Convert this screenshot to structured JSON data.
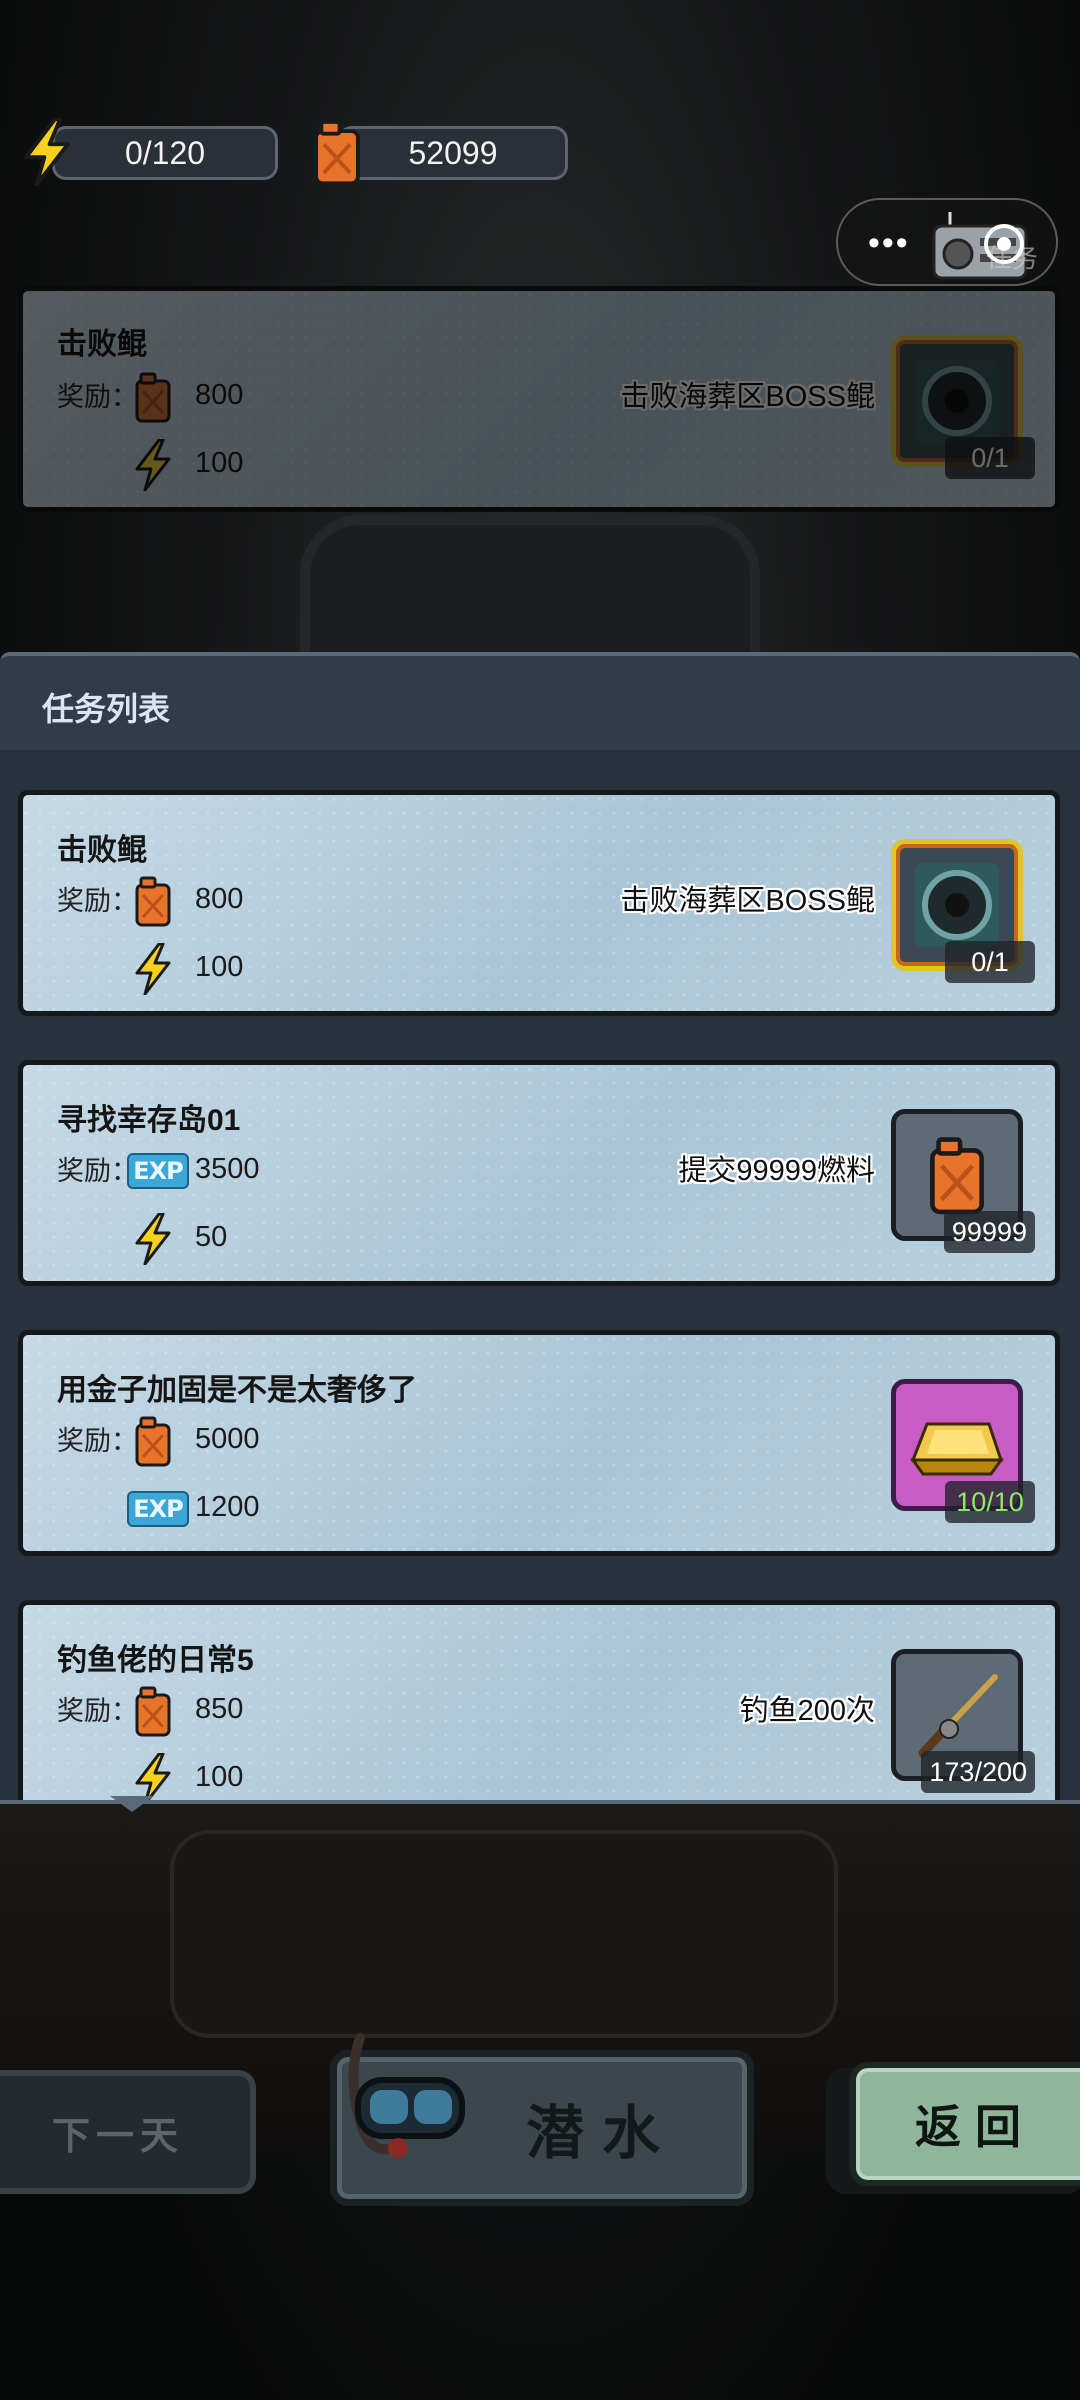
{
  "resources": {
    "energy": "0/120",
    "fuel": "52099"
  },
  "capsule": {
    "dots": "•••",
    "label": "任务"
  },
  "featured_quest": {
    "title": "击败鲲",
    "reward_label": "奖励：",
    "rewards": [
      {
        "icon": "fuel-can-icon",
        "value": "800"
      },
      {
        "icon": "lightning-icon",
        "value": "100"
      }
    ],
    "description": "击败海葬区BOSS鲲",
    "item_icon": "vault-icon",
    "progress": "0/1"
  },
  "panel": {
    "title": "任务列表"
  },
  "quests": [
    {
      "title": "击败鲲",
      "reward_label": "奖励：",
      "rewards": [
        {
          "icon": "fuel-can-icon",
          "value": "800"
        },
        {
          "icon": "lightning-icon",
          "value": "100"
        }
      ],
      "description": "击败海葬区BOSS鲲",
      "item_icon": "vault-icon",
      "progress": "0/1"
    },
    {
      "title": "寻找幸存岛01",
      "reward_label": "奖励：",
      "rewards": [
        {
          "icon": "exp-icon",
          "value": "3500"
        },
        {
          "icon": "lightning-icon",
          "value": "50"
        }
      ],
      "description": "提交99999燃料",
      "item_icon": "fuel-can-icon",
      "progress": "99999"
    },
    {
      "title": "用金子加固是不是太奢侈了",
      "reward_label": "奖励：",
      "rewards": [
        {
          "icon": "fuel-can-icon",
          "value": "5000"
        },
        {
          "icon": "exp-icon",
          "value": "1200"
        }
      ],
      "description": "",
      "item_icon": "gold-bar-icon",
      "progress": "10/10"
    },
    {
      "title": "钓鱼佬的日常5",
      "reward_label": "奖励：",
      "rewards": [
        {
          "icon": "fuel-can-icon",
          "value": "850"
        },
        {
          "icon": "lightning-icon",
          "value": "100"
        }
      ],
      "description": "钓鱼200次",
      "item_icon": "fishing-rod-icon",
      "progress": "173/200"
    }
  ],
  "exp_text": "EXP",
  "buttons": {
    "next_day": "下一天",
    "dive": "潜水",
    "back": "返回"
  },
  "colors": {
    "card_bg": "#b9d0de",
    "gold_frame": "#e0c52a",
    "done_progress": "#8ee86a",
    "back_button": "#8fb59a"
  }
}
